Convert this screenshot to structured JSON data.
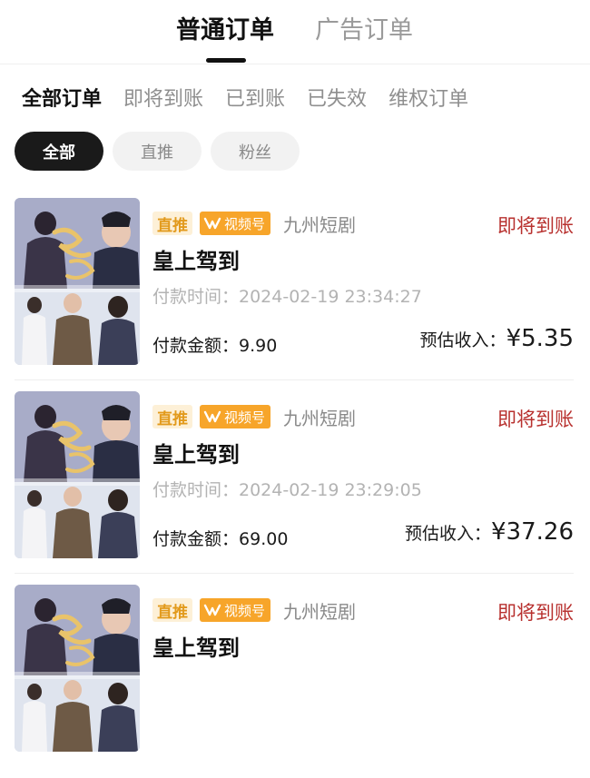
{
  "top_tabs": [
    {
      "label": "普通订单",
      "active": true
    },
    {
      "label": "广告订单",
      "active": false
    }
  ],
  "status_filters": [
    {
      "label": "全部订单",
      "active": true
    },
    {
      "label": "即将到账",
      "active": false
    },
    {
      "label": "已到账",
      "active": false
    },
    {
      "label": "已失效",
      "active": false
    },
    {
      "label": "维权订单",
      "active": false
    }
  ],
  "pills": [
    {
      "label": "全部",
      "active": true
    },
    {
      "label": "直推",
      "active": false
    },
    {
      "label": "粉丝",
      "active": false
    }
  ],
  "orders": [
    {
      "tag_direct": "直推",
      "tag_channel": "视频号",
      "source": "九州短剧",
      "status": "即将到账",
      "title": "皇上驾到",
      "pay_time": "付款时间：2024-02-19 23:34:27",
      "amount_label": "付款金额：",
      "amount_value": "9.90",
      "income_label": "预估收入：",
      "income_value": "¥5.35"
    },
    {
      "tag_direct": "直推",
      "tag_channel": "视频号",
      "source": "九州短剧",
      "status": "即将到账",
      "title": "皇上驾到",
      "pay_time": "付款时间：2024-02-19 23:29:05",
      "amount_label": "付款金额：",
      "amount_value": "69.00",
      "income_label": "预估收入：",
      "income_value": "¥37.26"
    },
    {
      "tag_direct": "直推",
      "tag_channel": "视频号",
      "source": "九州短剧",
      "status": "即将到账",
      "title": "皇上驾到"
    }
  ],
  "colors": {
    "status_pending": "#b8312f",
    "tag_direct_bg": "#fdf0d7",
    "tag_direct_text": "#e29a1c",
    "tag_channel_bg": "#f7a52a"
  },
  "icons": {
    "channel": "video-channel-icon",
    "poster": "drama-poster-image"
  }
}
